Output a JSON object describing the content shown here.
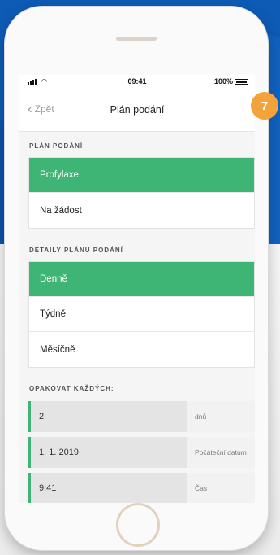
{
  "status_bar": {
    "time": "09:41",
    "battery_percent": "100%"
  },
  "nav": {
    "back_label": "Zpět",
    "title": "Plán podání"
  },
  "plan_section": {
    "label": "PLÁN PODÁNÍ",
    "options": [
      {
        "label": "Profylaxe",
        "selected": true
      },
      {
        "label": "Na žádost",
        "selected": false
      }
    ]
  },
  "detail_section": {
    "label": "DETAILY PLÁNU PODÁNÍ",
    "options": [
      {
        "label": "Denně",
        "selected": true
      },
      {
        "label": "Týdně",
        "selected": false
      },
      {
        "label": "Měsíčně",
        "selected": false
      }
    ]
  },
  "repeat_section": {
    "label": "OPAKOVAT KAŽDÝCH:",
    "rows": [
      {
        "value": "2",
        "unit": "dnů"
      },
      {
        "value": "1. 1. 2019",
        "unit": "Počáteční datum"
      },
      {
        "value": "9:41",
        "unit": "Čas"
      }
    ]
  },
  "step_badge": "7",
  "colors": {
    "accent_green": "#3eb575",
    "badge_orange": "#f2a33c",
    "background_blue": "#0e5bb5"
  }
}
